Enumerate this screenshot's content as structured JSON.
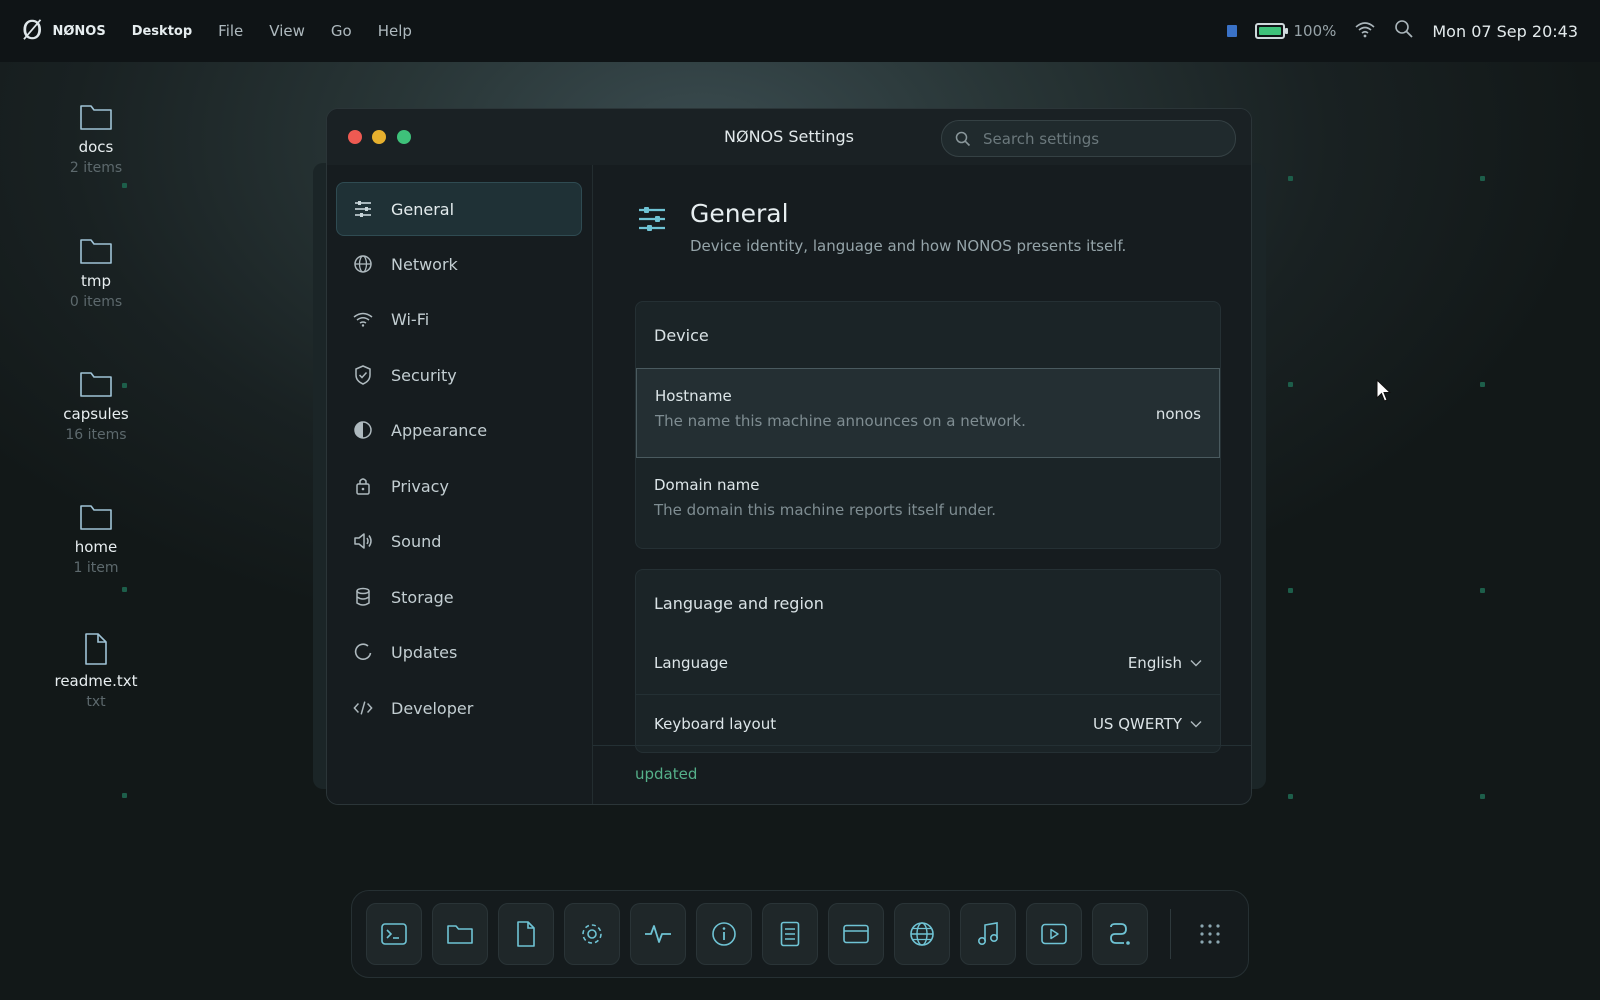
{
  "topbar": {
    "brand": "NØNOS",
    "menu": [
      "Desktop",
      "File",
      "View",
      "Go",
      "Help"
    ],
    "battery_percent": "100%",
    "battery_level": 1.0,
    "clock": "Mon 07 Sep  20:43",
    "icons": [
      "nonos-logo-icon",
      "app-indicator-icon",
      "battery-icon",
      "wifi-icon",
      "search-icon"
    ]
  },
  "desktop": {
    "items": [
      {
        "name": "docs",
        "meta": "2 items",
        "icon": "folder-icon"
      },
      {
        "name": "tmp",
        "meta": "0 items",
        "icon": "folder-icon"
      },
      {
        "name": "capsules",
        "meta": "16 items",
        "icon": "folder-icon"
      },
      {
        "name": "home",
        "meta": "1 item",
        "icon": "folder-icon"
      },
      {
        "name": "readme.txt",
        "meta": "txt",
        "icon": "file-icon"
      }
    ]
  },
  "window": {
    "title": "NØNOS Settings",
    "search_placeholder": "Search settings",
    "sidebar": [
      {
        "label": "General",
        "icon": "sliders-icon",
        "active": true
      },
      {
        "label": "Network",
        "icon": "globe-icon"
      },
      {
        "label": "Wi-Fi",
        "icon": "wifi-icon"
      },
      {
        "label": "Security",
        "icon": "shield-icon"
      },
      {
        "label": "Appearance",
        "icon": "contrast-icon"
      },
      {
        "label": "Privacy",
        "icon": "lock-icon"
      },
      {
        "label": "Sound",
        "icon": "speaker-icon"
      },
      {
        "label": "Storage",
        "icon": "database-icon"
      },
      {
        "label": "Updates",
        "icon": "refresh-icon"
      },
      {
        "label": "Developer",
        "icon": "code-icon"
      }
    ],
    "page": {
      "title": "General",
      "subtitle": "Device identity, language and how NONOS presents itself."
    },
    "device_card": {
      "heading": "Device",
      "hostname_label": "Hostname",
      "hostname_desc": "The name this machine announces on a network.",
      "hostname_value": "nonos",
      "domain_label": "Domain name",
      "domain_desc": "The domain this machine reports itself under."
    },
    "language_card": {
      "heading": "Language and region",
      "language_label": "Language",
      "language_value": "English",
      "keyboard_label": "Keyboard layout",
      "keyboard_value": "US QWERTY"
    },
    "status": "updated"
  },
  "dock": {
    "items": [
      "terminal-icon",
      "folder-icon",
      "file-icon",
      "settings-gear-icon",
      "activity-icon",
      "info-icon",
      "document-icon",
      "window-icon",
      "globe-icon",
      "music-icon",
      "video-icon",
      "path-icon",
      "app-grid-icon"
    ]
  },
  "colors": {
    "accent": "#55b08a",
    "close": "#ee5a52",
    "minimize": "#e6b02e",
    "maximize": "#3ec27a"
  }
}
